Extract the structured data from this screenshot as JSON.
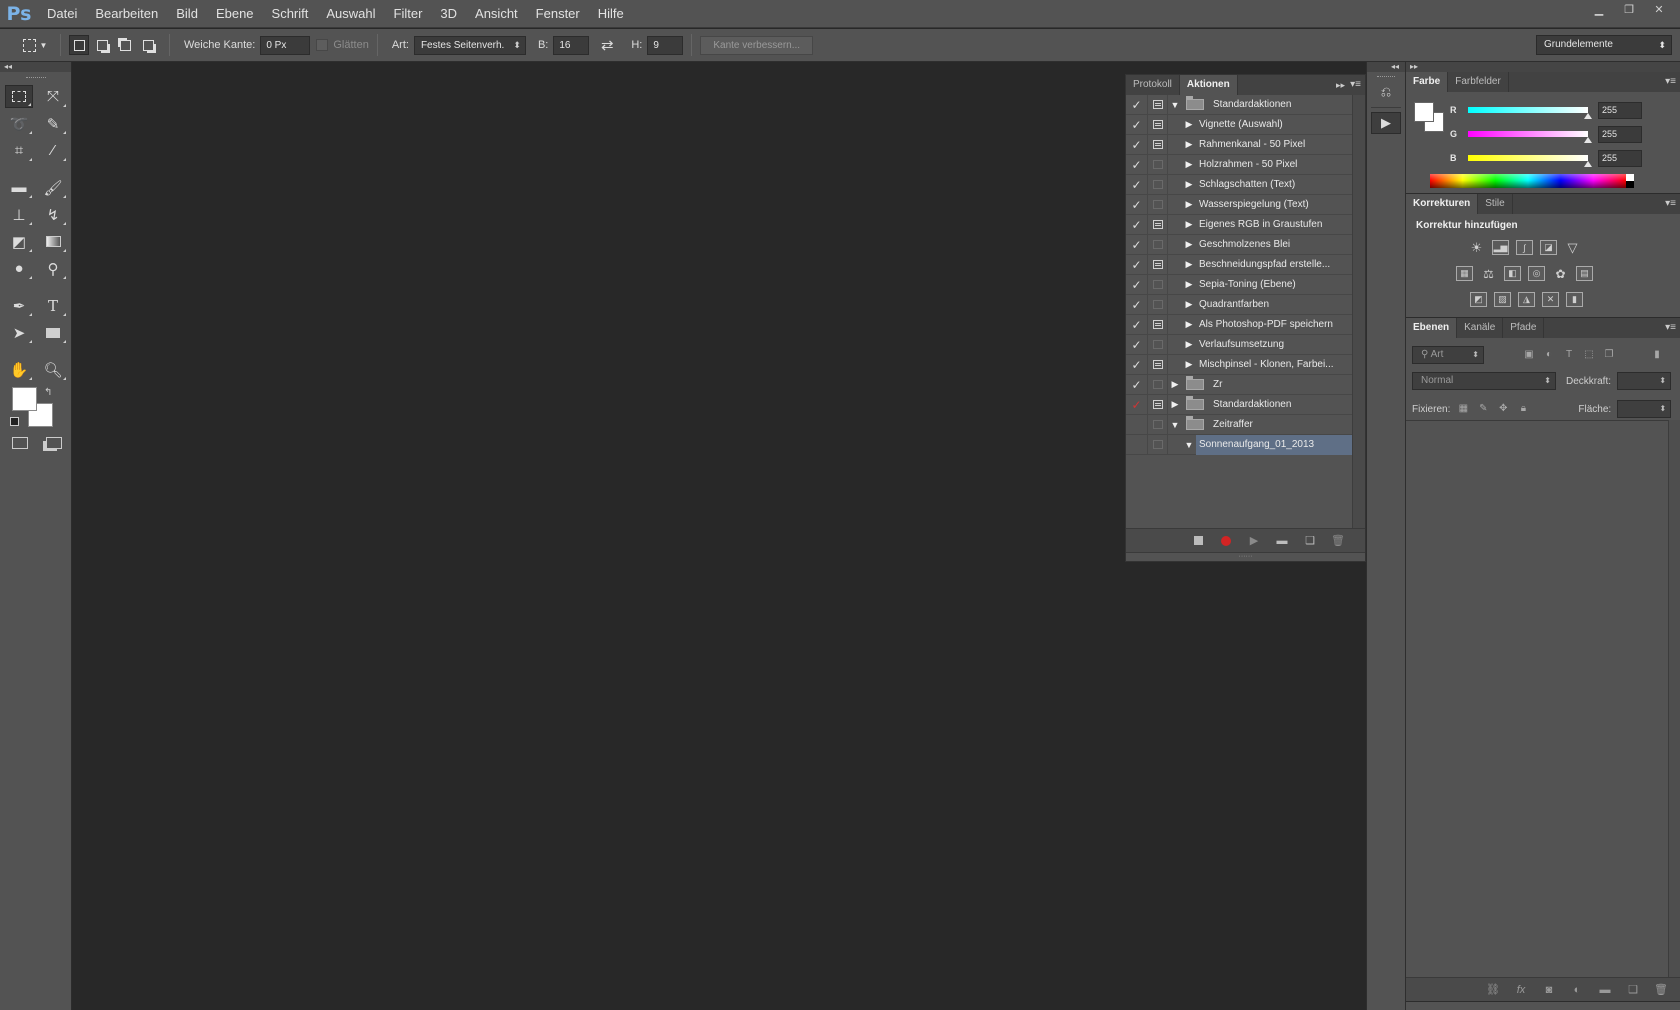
{
  "app": {
    "logo": "Ps"
  },
  "menu": [
    "Datei",
    "Bearbeiten",
    "Bild",
    "Ebene",
    "Schrift",
    "Auswahl",
    "Filter",
    "3D",
    "Ansicht",
    "Fenster",
    "Hilfe"
  ],
  "window_controls": [
    "minimize-icon",
    "restore-icon",
    "close-icon"
  ],
  "options": {
    "feather_label": "Weiche Kante:",
    "feather_value": "0 Px",
    "antialias_label": "Glätten",
    "style_label": "Art:",
    "style_value": "Festes Seitenverh.",
    "width_label": "B:",
    "width_value": "16",
    "height_label": "H:",
    "height_value": "9",
    "refine_label": "Kante verbessern...",
    "workspace": "Grundelemente"
  },
  "actions_panel": {
    "tabs": [
      "Protokoll",
      "Aktionen"
    ],
    "active_tab": "Aktionen",
    "rows": [
      {
        "label": "Standardaktionen",
        "kind": "set-open",
        "checked": true,
        "dialog": "filled"
      },
      {
        "label": "Vignette (Auswahl)",
        "kind": "action",
        "checked": true,
        "dialog": "filled"
      },
      {
        "label": "Rahmenkanal - 50 Pixel",
        "kind": "action",
        "checked": true,
        "dialog": "filled"
      },
      {
        "label": "Holzrahmen - 50 Pixel",
        "kind": "action",
        "checked": true,
        "dialog": "empty"
      },
      {
        "label": "Schlagschatten (Text)",
        "kind": "action",
        "checked": true,
        "dialog": "empty"
      },
      {
        "label": "Wasserspiegelung (Text)",
        "kind": "action",
        "checked": true,
        "dialog": "empty"
      },
      {
        "label": "Eigenes RGB in Graustufen",
        "kind": "action",
        "checked": true,
        "dialog": "filled"
      },
      {
        "label": "Geschmolzenes Blei",
        "kind": "action",
        "checked": true,
        "dialog": "empty"
      },
      {
        "label": "Beschneidungspfad erstelle...",
        "kind": "action",
        "checked": true,
        "dialog": "filled"
      },
      {
        "label": "Sepia-Toning (Ebene)",
        "kind": "action",
        "checked": true,
        "dialog": "empty"
      },
      {
        "label": "Quadrantfarben",
        "kind": "action",
        "checked": true,
        "dialog": "empty"
      },
      {
        "label": "Als Photoshop-PDF speichern",
        "kind": "action",
        "checked": true,
        "dialog": "filled"
      },
      {
        "label": "Verlaufsumsetzung",
        "kind": "action",
        "checked": true,
        "dialog": "empty"
      },
      {
        "label": "Mischpinsel - Klonen, Farbei...",
        "kind": "action",
        "checked": true,
        "dialog": "filled"
      },
      {
        "label": "Zr",
        "kind": "set-closed",
        "checked": true,
        "dialog": "empty"
      },
      {
        "label": "Standardaktionen",
        "kind": "set-closed",
        "checked": "red",
        "dialog": "filled"
      },
      {
        "label": "Zeitraffer",
        "kind": "set-open",
        "checked": false,
        "dialog": "empty"
      },
      {
        "label": "Sonnenaufgang_01_2013",
        "kind": "action-open",
        "checked": false,
        "dialog": "empty",
        "selected": true
      }
    ]
  },
  "color_panel": {
    "tabs": [
      "Farbe",
      "Farbfelder"
    ],
    "channels": [
      {
        "name": "R",
        "value": "255",
        "color": "#00e5ff"
      },
      {
        "name": "G",
        "value": "255",
        "color": "#ff2bd6"
      },
      {
        "name": "B",
        "value": "255",
        "color": "#fff200"
      }
    ],
    "foreground": "#ffffff",
    "background": "#ffffff"
  },
  "adjust_panel": {
    "tabs": [
      "Korrekturen",
      "Stile"
    ],
    "title": "Korrektur hinzufügen"
  },
  "layers_panel": {
    "tabs": [
      "Ebenen",
      "Kanäle",
      "Pfade"
    ],
    "filter_kind": "Art",
    "blend_mode": "Normal",
    "opacity_label": "Deckkraft:",
    "lock_label": "Fixieren:",
    "fill_label": "Fläche:"
  },
  "colors": {
    "ui_bg": "#535353",
    "canvas_bg": "#282828",
    "selected_row": "#5f6f86",
    "record": "#d32424"
  }
}
